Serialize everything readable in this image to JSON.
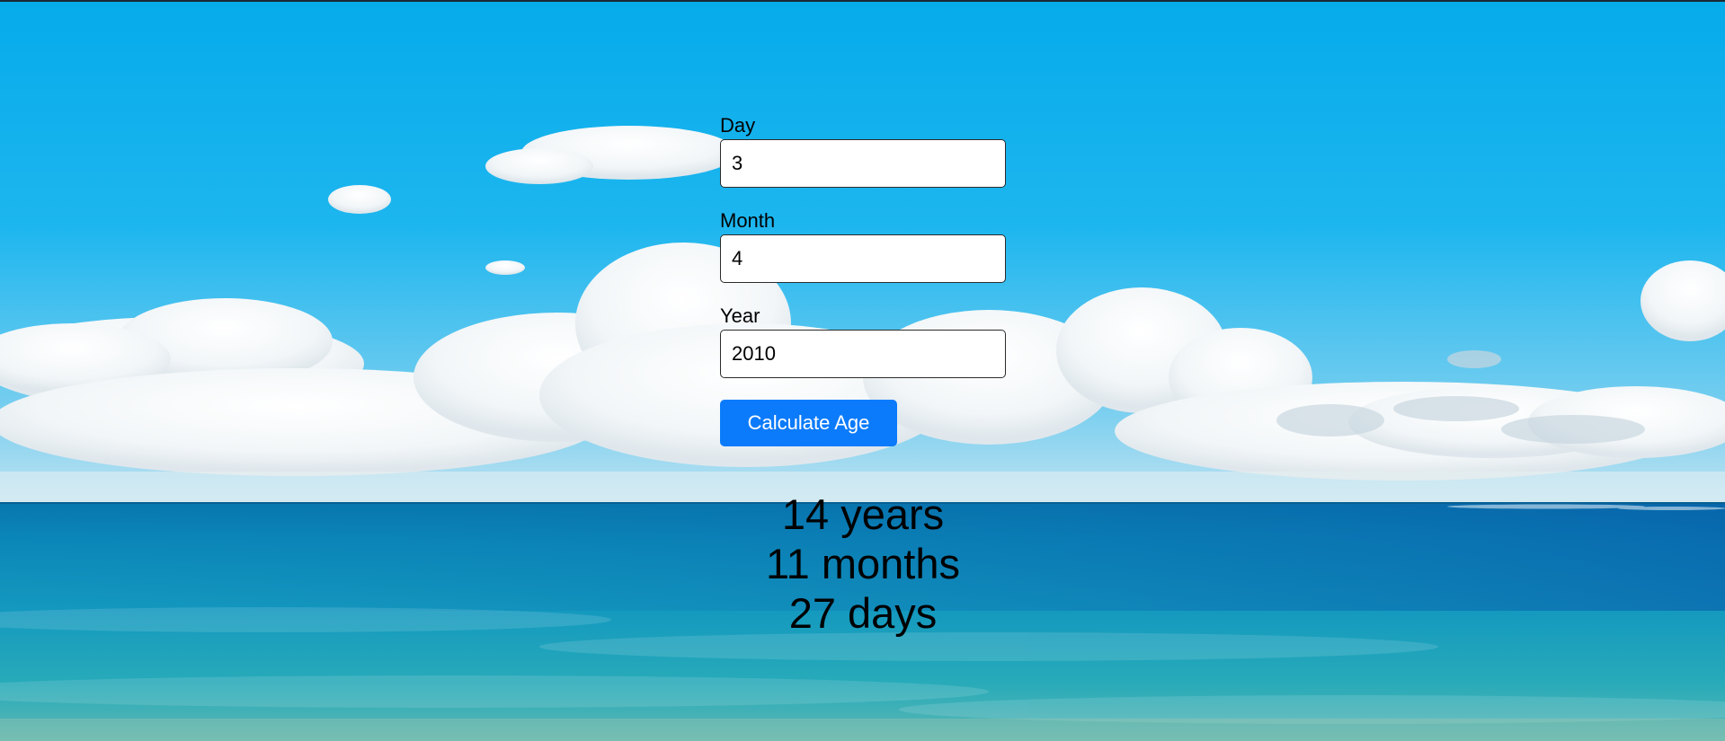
{
  "form": {
    "day": {
      "label": "Day",
      "value": "3"
    },
    "month": {
      "label": "Month",
      "value": "4"
    },
    "year": {
      "label": "Year",
      "value": "2010"
    },
    "button_label": "Calculate Age"
  },
  "result": {
    "years": "14 years",
    "months": "11 months",
    "days": "27 days"
  },
  "colors": {
    "button": "#0b7bfb",
    "sky": "#0fb0ec",
    "ocean": "#0a8fbf"
  }
}
